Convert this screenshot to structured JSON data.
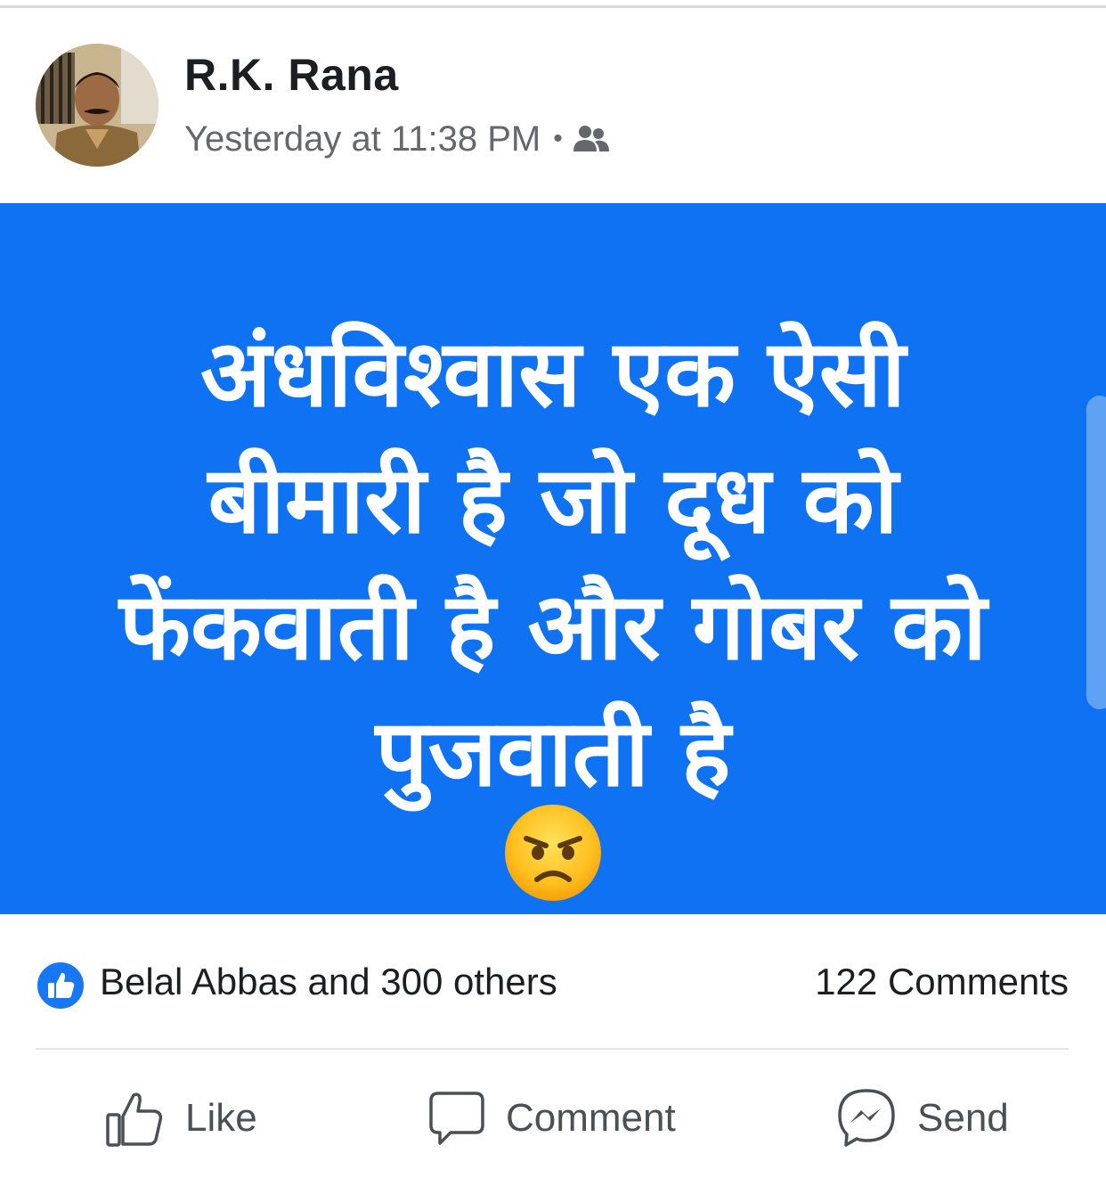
{
  "post": {
    "author": "R.K. Rana",
    "timestamp": "Yesterday at 11:38 PM",
    "separator": "•",
    "audience_icon": "friends-icon",
    "image_text_lines": [
      "अंधविश्वास एक ऐसी",
      "बीमारी है जो दूध को",
      "फेंकवाती है और गोबर को",
      "पुजवाती है"
    ],
    "image_emoji": "angry-face-emoji",
    "image_background_color": "#0f72f2"
  },
  "reactions": {
    "icon": "like-reaction-icon",
    "summary": "Belal Abbas and 300 others",
    "comments": "122 Comments"
  },
  "actions": {
    "like_label": "Like",
    "comment_label": "Comment",
    "send_label": "Send"
  },
  "colors": {
    "brand_blue": "#1877f2",
    "secondary_text": "#65676b"
  }
}
